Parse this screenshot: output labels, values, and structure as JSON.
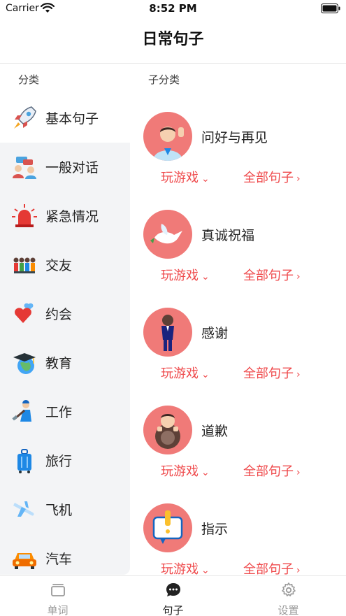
{
  "status_bar": {
    "carrier": "Carrier",
    "time": "8:52 PM"
  },
  "nav": {
    "title": "日常句子"
  },
  "headers": {
    "category": "分类",
    "subcategory": "子分类"
  },
  "sidebar": {
    "items": [
      {
        "label": "基本句子",
        "icon": "rocket-icon"
      },
      {
        "label": "一般对话",
        "icon": "conversation-icon"
      },
      {
        "label": "紧急情况",
        "icon": "siren-icon"
      },
      {
        "label": "交友",
        "icon": "friends-icon"
      },
      {
        "label": "约会",
        "icon": "hearts-icon"
      },
      {
        "label": "教育",
        "icon": "graduation-globe-icon"
      },
      {
        "label": "工作",
        "icon": "worker-icon"
      },
      {
        "label": "旅行",
        "icon": "luggage-icon"
      },
      {
        "label": "飞机",
        "icon": "airplane-icon"
      },
      {
        "label": "汽车",
        "icon": "car-icon"
      }
    ]
  },
  "cards": [
    {
      "title": "问好与再见",
      "play": "玩游戏",
      "all": "全部句子",
      "icon": "waving-man-icon"
    },
    {
      "title": "真诚祝福",
      "play": "玩游戏",
      "all": "全部句子",
      "icon": "dove-icon"
    },
    {
      "title": "感谢",
      "play": "玩游戏",
      "all": "全部句子",
      "icon": "bowing-man-icon"
    },
    {
      "title": "道歉",
      "play": "玩游戏",
      "all": "全部句子",
      "icon": "apologizing-man-icon"
    },
    {
      "title": "指示",
      "play": "玩游戏",
      "all": "全部句子",
      "icon": "notice-sign-icon"
    }
  ],
  "tabbar": {
    "tabs": [
      {
        "label": "单词",
        "icon": "cards-icon",
        "active": false
      },
      {
        "label": "句子",
        "icon": "chat-bubble-icon",
        "active": true
      },
      {
        "label": "设置",
        "icon": "gear-icon",
        "active": false
      }
    ]
  },
  "colors": {
    "accent": "#ef4a4c",
    "avatar_bg": "#f07a78",
    "sidebar_bg": "#f3f4f6"
  }
}
